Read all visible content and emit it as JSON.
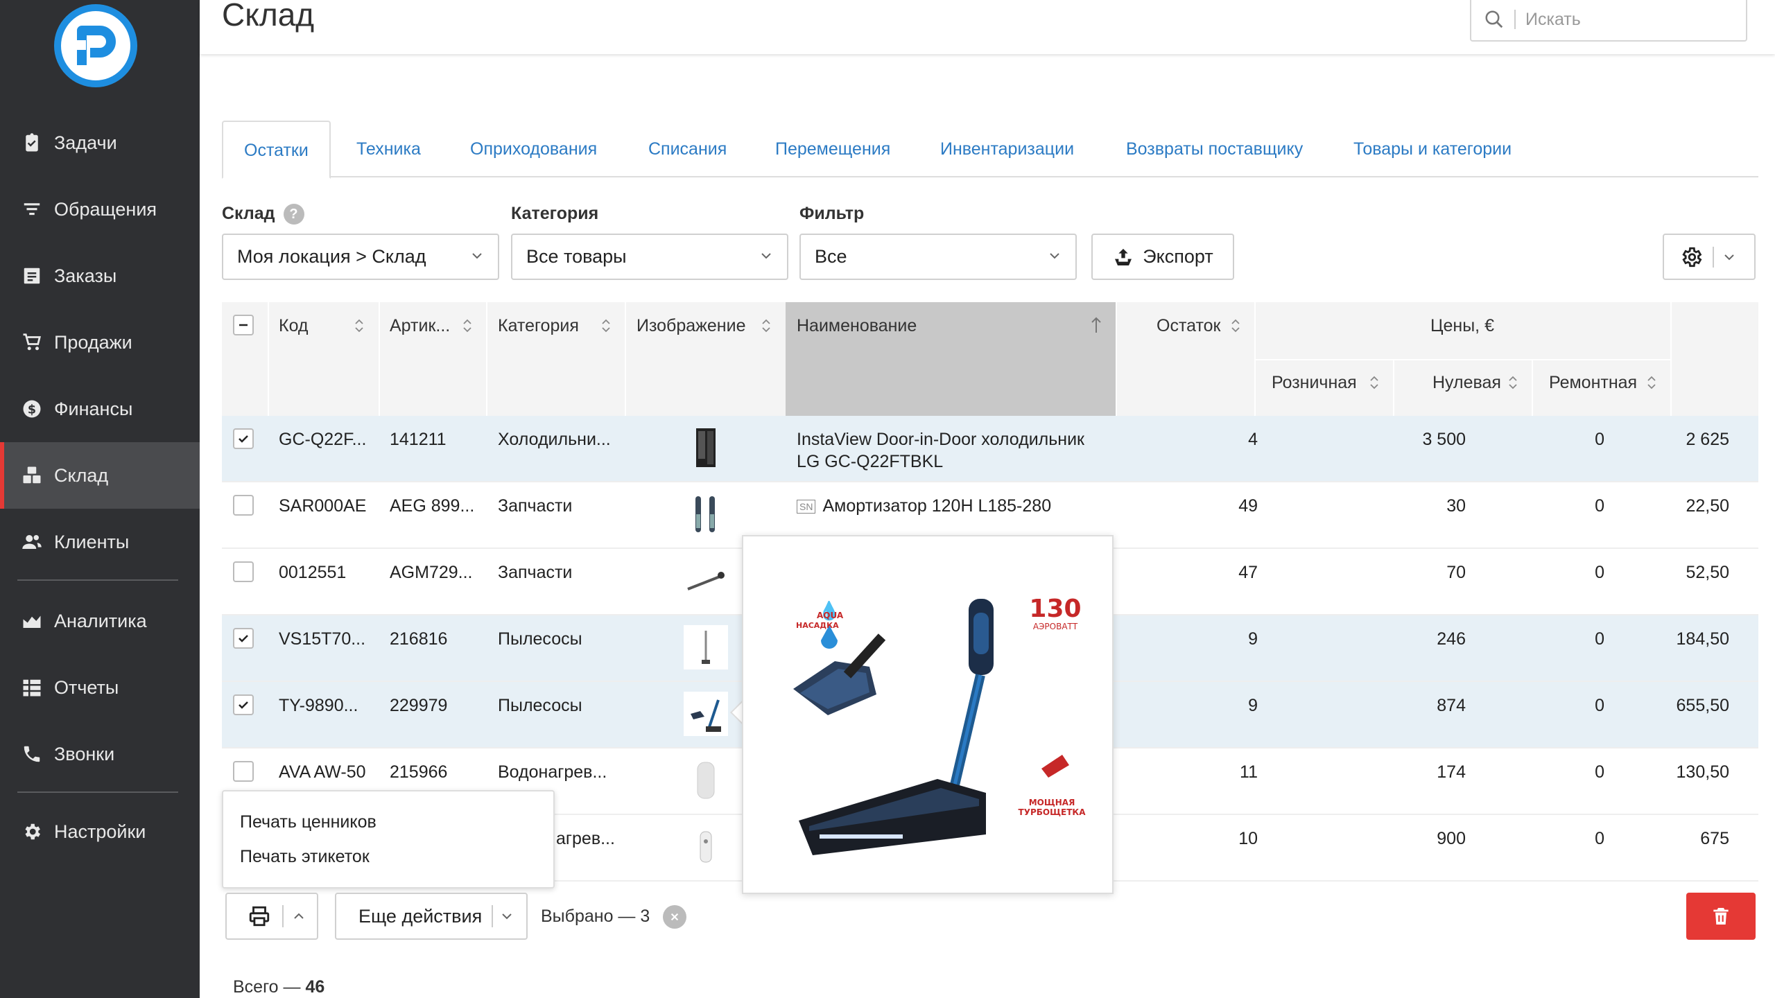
{
  "colors": {
    "accent": "#2c7bc4",
    "danger": "#e53935",
    "sidebar": "#2f3033",
    "selected_row": "#e7f0f6"
  },
  "sidebar": {
    "items": [
      {
        "label": "Задачи",
        "icon": "clipboard-check-icon"
      },
      {
        "label": "Обращения",
        "icon": "filter-icon"
      },
      {
        "label": "Заказы",
        "icon": "order-list-icon"
      },
      {
        "label": "Продажи",
        "icon": "cart-icon"
      },
      {
        "label": "Финансы",
        "icon": "dollar-icon"
      },
      {
        "label": "Склад",
        "icon": "boxes-icon",
        "active": true
      },
      {
        "label": "Клиенты",
        "icon": "users-icon"
      },
      {
        "label": "Аналитика",
        "icon": "area-chart-icon"
      },
      {
        "label": "Отчеты",
        "icon": "grid-list-icon"
      },
      {
        "label": "Звонки",
        "icon": "phone-icon"
      },
      {
        "label": "Настройки",
        "icon": "gear-icon"
      }
    ]
  },
  "header": {
    "title": "Склад",
    "search_placeholder": "Искать"
  },
  "tabs": [
    "Остатки",
    "Техника",
    "Оприходования",
    "Списания",
    "Перемещения",
    "Инвентаризации",
    "Возвраты поставщику",
    "Товары и категории"
  ],
  "filters": {
    "warehouse": {
      "label": "Склад",
      "help": "?",
      "value": "Моя локация > Склад"
    },
    "category": {
      "label": "Категория",
      "value": "Все товары"
    },
    "filter": {
      "label": "Фильтр",
      "value": "Все"
    },
    "export_label": "Экспорт"
  },
  "table": {
    "headers": {
      "code": "Код",
      "article": "Артик...",
      "category": "Категория",
      "image": "Изображение",
      "name": "Наименование",
      "stock": "Остаток",
      "prices": "Цены, €",
      "retail": "Розничная",
      "zero": "Нулевая",
      "repair": "Ремонтная"
    },
    "rows": [
      {
        "checked": true,
        "code": "GC-Q22F...",
        "article": "141211",
        "category": "Холодильни...",
        "name": "InstaView Door-in-Door холодильник",
        "name2": "LG GC-Q22FTBKL",
        "sn": "",
        "stock": "4",
        "retail": "3 500",
        "zero": "0",
        "repair": "2 625"
      },
      {
        "checked": false,
        "code": "SAR000AE",
        "article": "AEG 899...",
        "category": "Запчасти",
        "name": "Амортизатор 120H L185-280",
        "name2": "",
        "sn": "SN",
        "stock": "49",
        "retail": "30",
        "zero": "0",
        "repair": "22,50"
      },
      {
        "checked": false,
        "code": "0012551",
        "article": "AGM729...",
        "category": "Запчасти",
        "name": "",
        "name2": "",
        "sn": "",
        "stock": "47",
        "retail": "70",
        "zero": "0",
        "repair": "52,50"
      },
      {
        "checked": true,
        "code": "VS15T70...",
        "article": "216816",
        "category": "Пылесосы",
        "name": "",
        "name2": "",
        "sn": "",
        "stock": "9",
        "retail": "246",
        "zero": "0",
        "repair": "184,50"
      },
      {
        "checked": true,
        "code": "TY-9890...",
        "article": "229979",
        "category": "Пылесосы",
        "name": "",
        "name2": "",
        "sn": "",
        "stock": "9",
        "retail": "874",
        "zero": "0",
        "repair": "655,50"
      },
      {
        "checked": false,
        "code": "AVA AW-50",
        "article": "215966",
        "category": "Водонагрев...",
        "name": "",
        "name2": "",
        "sn": "",
        "stock": "11",
        "retail": "174",
        "zero": "0",
        "repair": "130,50"
      },
      {
        "checked": false,
        "code": "",
        "article": "",
        "category": "агрев...",
        "name": "",
        "name2": "",
        "sn": "",
        "stock": "10",
        "retail": "900",
        "zero": "0",
        "repair": "675"
      }
    ]
  },
  "popup": {
    "badge_aqua": "AQUA",
    "badge_aqua2": "НАСАДКА",
    "badge_power": "130",
    "badge_power2": "АЭРОВАТТ",
    "badge_turbo": "МОЩНАЯ",
    "badge_turbo2": "ТУРБОЩЕТКА"
  },
  "print_menu": [
    "Печать ценников",
    "Печать этикеток"
  ],
  "actions": {
    "more": "Еще действия",
    "selected": "Выбрано — 3"
  },
  "total": {
    "label": "Всего — ",
    "count": "46"
  }
}
